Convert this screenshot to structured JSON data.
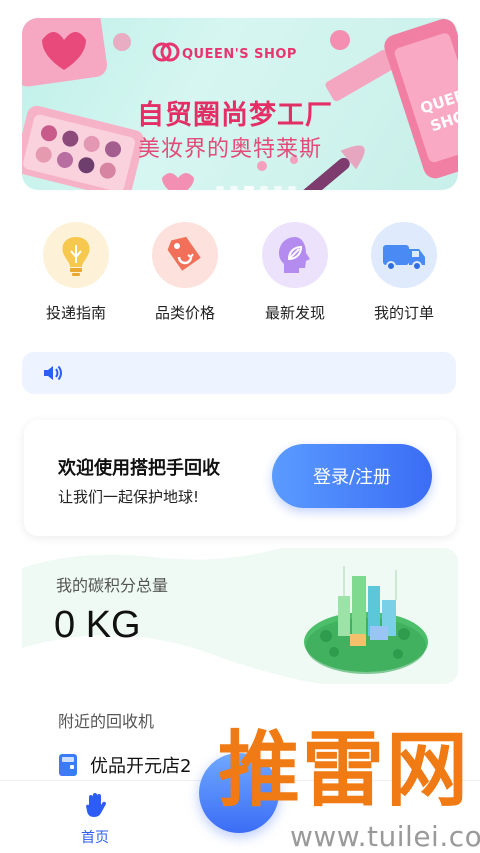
{
  "banner": {
    "brand": "QUEEN'S SHOP",
    "headline": "自贸圈尚梦工厂",
    "subline": "美妆界的奥特莱斯",
    "phone_text": "QUEEN SHOP",
    "slides": 6,
    "active_slide": 3
  },
  "quick_links": [
    {
      "label": "投递指南",
      "icon": "lightbulb-icon",
      "color": "#f5c04a"
    },
    {
      "label": "品类价格",
      "icon": "price-tag-icon",
      "color": "#f2705a"
    },
    {
      "label": "最新发现",
      "icon": "leaf-head-icon",
      "color": "#b48cf0"
    },
    {
      "label": "我的订单",
      "icon": "truck-icon",
      "color": "#4a8af5"
    }
  ],
  "notice": {
    "icon": "speaker-icon"
  },
  "login_card": {
    "welcome": "欢迎使用搭把手回收",
    "subtitle": "让我们一起保护地球!",
    "button": "登录/注册"
  },
  "carbon": {
    "label": "我的碳积分总量",
    "value": "0 KG"
  },
  "nearby": {
    "title": "附近的回收机",
    "station_name": "优品开元店2"
  },
  "tabbar": {
    "home_label": "首页"
  },
  "watermark": {
    "brand": "推雷网",
    "url": "www.tuilei.com"
  },
  "colors": {
    "accent": "#3b6df5",
    "brand_pink": "#e42f66",
    "watermark": "#f07a13"
  }
}
